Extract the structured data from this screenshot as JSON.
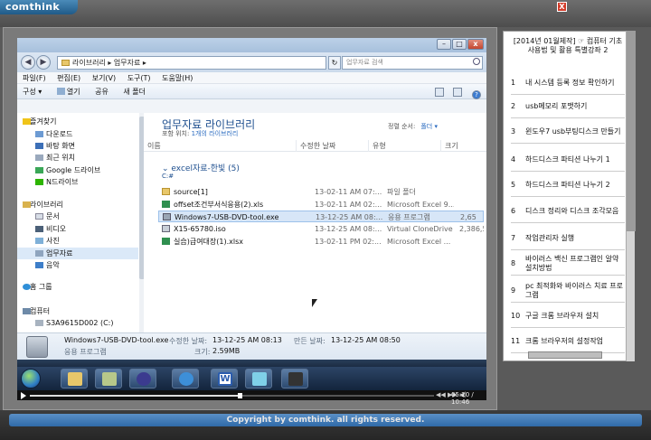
{
  "header": {
    "logo": "comthink",
    "close": "X"
  },
  "footer": {
    "copyright": "Copyright by comthink. all rights reserved."
  },
  "explorer": {
    "caption": {
      "min": "–",
      "max": "□",
      "close": "x"
    },
    "address": {
      "path": "라이브러리 ▸ 업무자료 ▸",
      "search_placeholder": "업무자료 검색"
    },
    "menu": [
      "파일(F)",
      "편집(E)",
      "보기(V)",
      "도구(T)",
      "도움말(H)"
    ],
    "toolbar": [
      "구성 ▾",
      "열기",
      "공유",
      "새 폴더"
    ],
    "nav": {
      "favorites_header": "즐겨찾기",
      "favorites": [
        "다운로드",
        "바탕 화면",
        "최근 위치",
        "Google 드라이브",
        "N드라이브"
      ],
      "libraries_header": "라이브러리",
      "libraries": [
        "문서",
        "비디오",
        "사진",
        "업무자료",
        "음악"
      ],
      "homegroup": "홈 그룹",
      "computer_header": "컴퓨터",
      "computer_item": "S3A9615D002 (C:)"
    },
    "library": {
      "title": "업무자료 라이브러리",
      "includes_label": "포함 위치:",
      "includes_link": "1개의 라이브러리",
      "arrange_label": "정렬 순서:",
      "arrange_value": "폴더 ▾"
    },
    "columns": [
      "이름",
      "수정한 날짜",
      "유형",
      "크기"
    ],
    "group": {
      "header": "excel자료-한빛 (5)",
      "path": "C:#"
    },
    "files": [
      {
        "name": "source[1]",
        "date": "13-02-11 AM 07:...",
        "type": "파일 폴더",
        "size": "",
        "kind": "folder"
      },
      {
        "name": "offset조건부서식응용(2).xls",
        "date": "13-02-11 AM 02:...",
        "type": "Microsoft Excel 9...",
        "size": "",
        "kind": "excel"
      },
      {
        "name": "Windows7-USB-DVD-tool.exe",
        "date": "13-12-25 AM 08:...",
        "type": "응용 프로그램",
        "size": "2,65",
        "kind": "exe"
      },
      {
        "name": "X15-65780.iso",
        "date": "13-12-25 AM 08:...",
        "type": "Virtual CloneDrive",
        "size": "2,386,5",
        "kind": "iso"
      },
      {
        "name": "실습)급여대장(1).xlsx",
        "date": "13-02-11 PM 02:...",
        "type": "Microsoft Excel ...",
        "size": "",
        "kind": "excel"
      }
    ],
    "details": {
      "name": "Windows7-USB-DVD-tool.exe",
      "type": "응용 프로그램",
      "modified_label": "수정한 날짜:",
      "modified_value": "13-12-25 AM 08:13",
      "size_label": "크기:",
      "size_value": "2.59MB",
      "created_label": "만든 날짜:",
      "created_value": "13-12-25 AM 08:50"
    }
  },
  "player": {
    "progress": 0.52,
    "controls": "◀◀ ▶▶ ◀) ",
    "time": "05:20 / 10:46"
  },
  "chapters": {
    "title": "[2014년 01월제작] ☞ 컴퓨터 기초 사용법 및 활용 특별강좌 2",
    "items": [
      {
        "num": "1",
        "text": "내 시스템 등록 정보 확인하기"
      },
      {
        "num": "2",
        "text": "usb메모리 포맷하기"
      },
      {
        "num": "3",
        "text": "윈도우7 usb부팅디스크 만들기"
      },
      {
        "num": "4",
        "text": "하드디스크 파티션 나누기 1"
      },
      {
        "num": "5",
        "text": "하드디스크 파티션 나누기 2"
      },
      {
        "num": "6",
        "text": "디스크 정리와 디스크 조각모음"
      },
      {
        "num": "7",
        "text": "작업관리자 실행"
      },
      {
        "num": "8",
        "text": "바이러스 백신 프로그램인 알약 설치방법"
      },
      {
        "num": "9",
        "text": "pc 최적화와 바이러스 치료 프로그램"
      },
      {
        "num": "10",
        "text": "구글 크롬 브라우저 설치"
      },
      {
        "num": "11",
        "text": "크롬 브라우저의 설정작업"
      }
    ]
  },
  "colors": {
    "accent": "#1e4f8f",
    "selection": "#d7e6f7",
    "chrome": "#5a5a5a"
  }
}
